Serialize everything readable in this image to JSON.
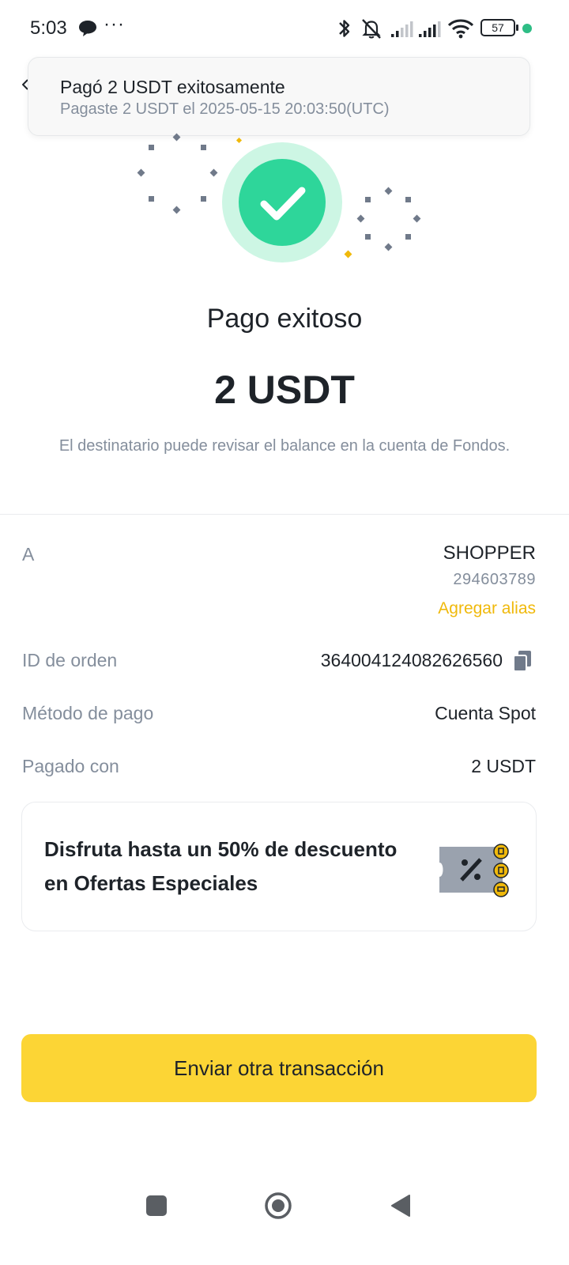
{
  "status_bar": {
    "time": "5:03",
    "more": "···",
    "battery": "57",
    "icons": [
      "chat-bubble-icon",
      "bluetooth-icon",
      "mute-icon",
      "signal-icon",
      "signal-icon",
      "wifi-icon",
      "battery-icon"
    ]
  },
  "notification": {
    "title": "Pagó 2 USDT exitosamente",
    "subtitle": "Pagaste 2 USDT el 2025-05-15 20:03:50(UTC)"
  },
  "result": {
    "heading": "Pago exitoso",
    "amount": "2 USDT",
    "note": "El destinatario puede revisar el balance en la cuenta de Fondos."
  },
  "details": {
    "to_label": "A",
    "recipient_name": "SHOPPER",
    "recipient_id": "294603789",
    "add_alias": "Agregar alias",
    "order_id_label": "ID de orden",
    "order_id": "364004124082626560",
    "payment_method_label": "Método de pago",
    "payment_method": "Cuenta Spot",
    "paid_with_label": "Pagado con",
    "paid_with": "2 USDT"
  },
  "promo": {
    "text": "Disfruta hasta un 50% de descuento en Ofertas Especiales"
  },
  "actions": {
    "primary": "Enviar otra transacción"
  },
  "colors": {
    "accent": "#fcd535",
    "success": "#2ed69a",
    "link": "#f0b90b",
    "muted_text": "#848e9c"
  }
}
